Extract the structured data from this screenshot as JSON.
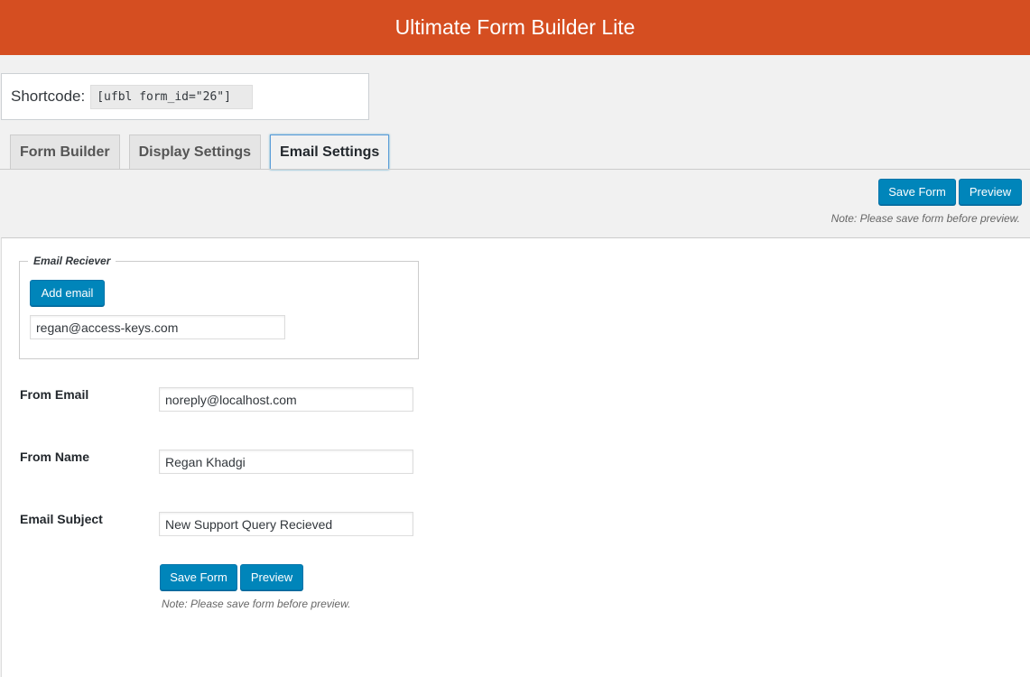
{
  "header": {
    "title": "Ultimate Form Builder Lite"
  },
  "shortcode": {
    "label": "Shortcode:",
    "value": "[ufbl form_id=\"26\"]"
  },
  "tabs": [
    {
      "label": "Form Builder",
      "active": false
    },
    {
      "label": "Display Settings",
      "active": false
    },
    {
      "label": "Email Settings",
      "active": true
    }
  ],
  "actions": {
    "save_label": "Save Form",
    "preview_label": "Preview",
    "note": "Note: Please save form before preview."
  },
  "email_receiver": {
    "legend": "Email Reciever",
    "add_label": "Add email",
    "emails": [
      "regan@access-keys.com"
    ]
  },
  "fields": {
    "from_email": {
      "label": "From Email",
      "value": "noreply@localhost.com"
    },
    "from_name": {
      "label": "From Name",
      "value": "Regan Khadgi"
    },
    "email_subject": {
      "label": "Email Subject",
      "value": "New Support Query Recieved"
    }
  },
  "colors": {
    "header": "#d54e21",
    "button": "#0085ba"
  }
}
